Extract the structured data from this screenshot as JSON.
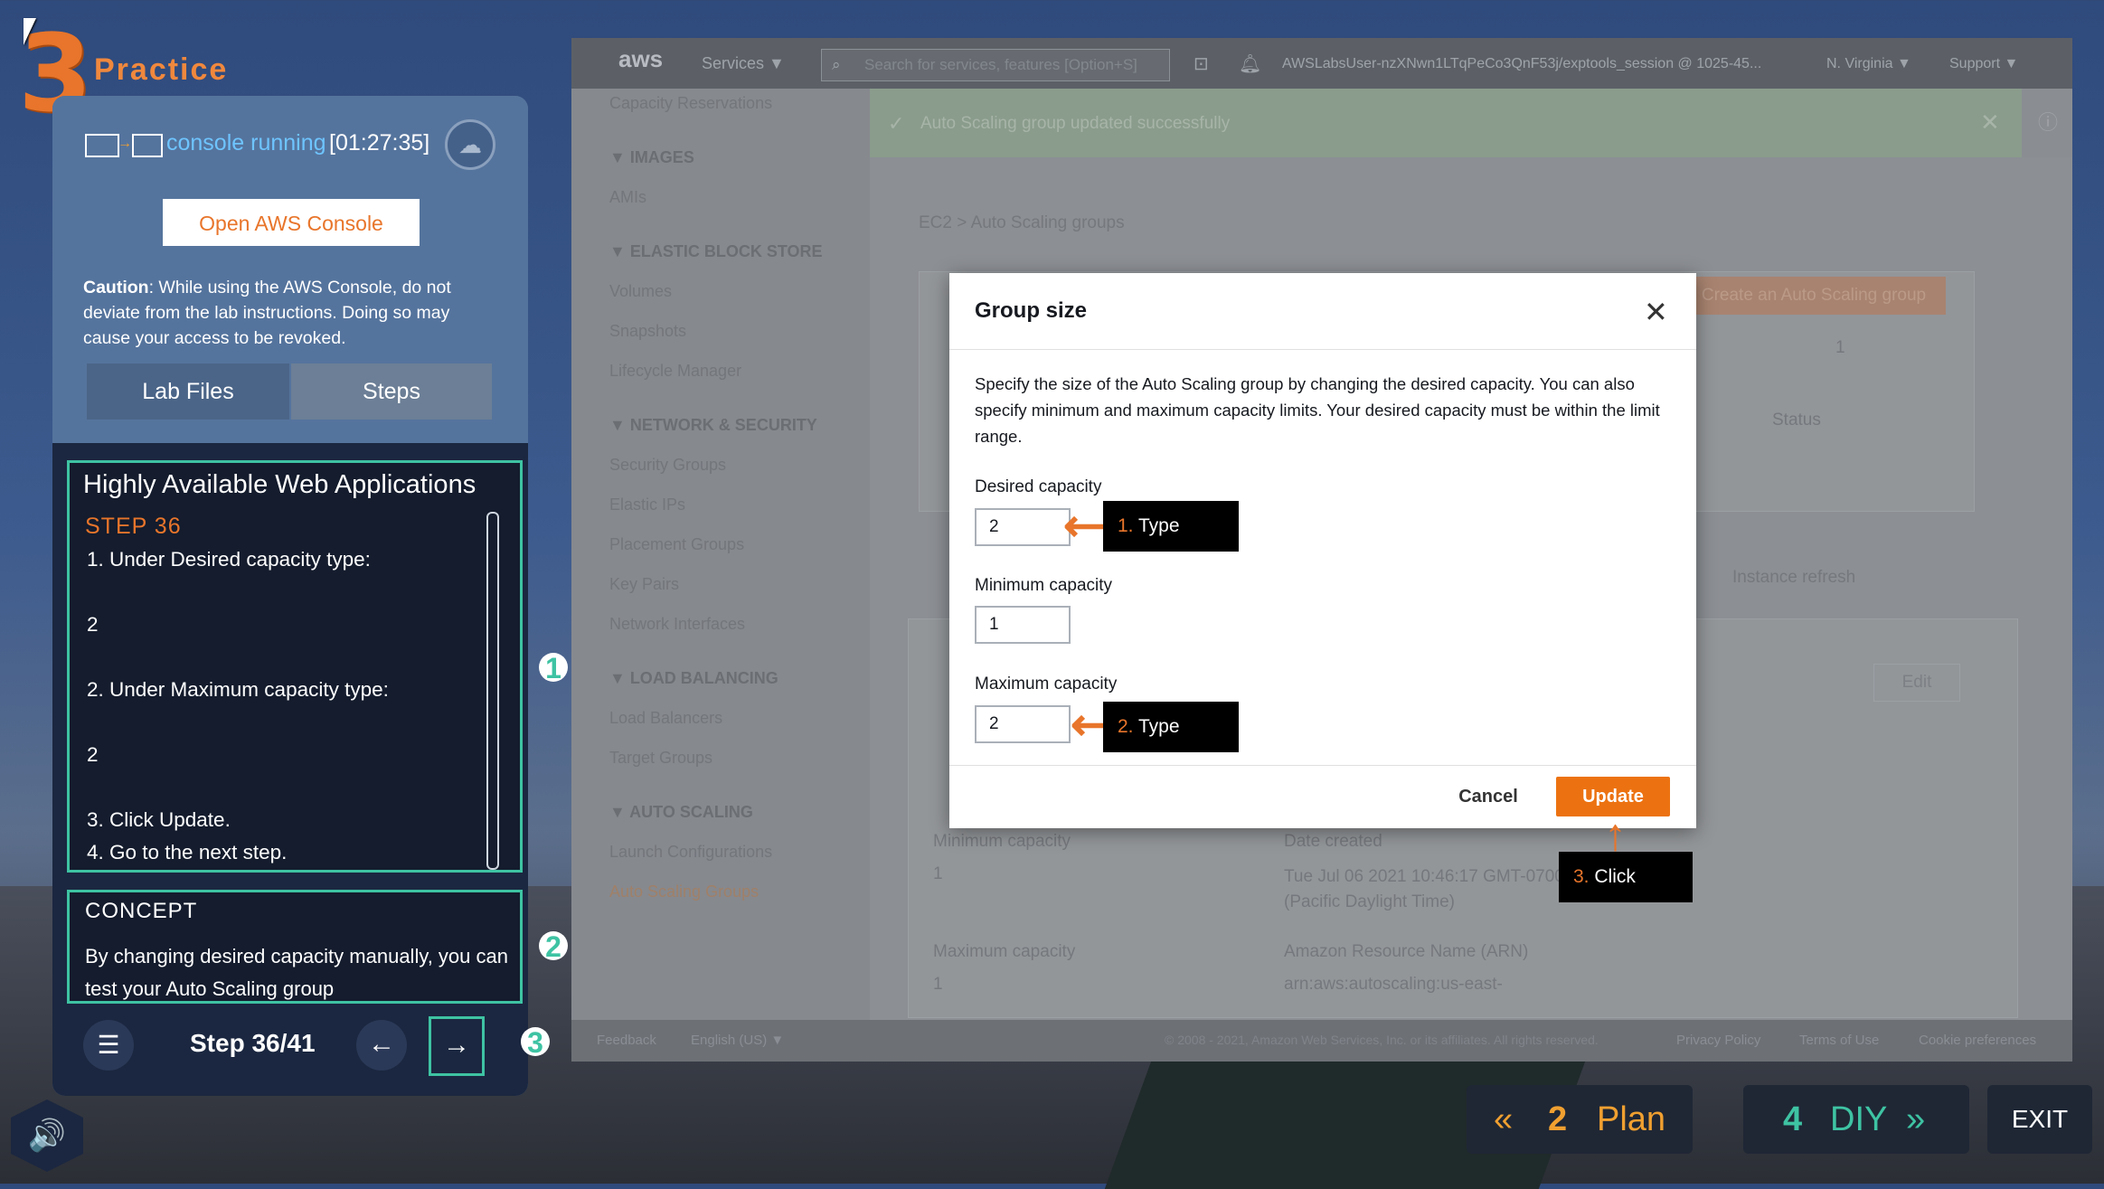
{
  "app": {
    "logo_number": "3",
    "logo_label": "Practice"
  },
  "status": {
    "console_label": "console running",
    "timer": "[01:27:35]"
  },
  "open_console_label": "Open AWS Console",
  "caution": {
    "bold": "Caution",
    "text": ": While using the AWS Console, do not deviate from the lab instructions. Doing so may cause your access to be revoked."
  },
  "tabs": [
    {
      "label": "Lab Files"
    },
    {
      "label": "Steps"
    }
  ],
  "step": {
    "title": "Highly Available Web Applications",
    "number": "STEP 36",
    "lines": [
      "1. Under Desired capacity type:",
      "2",
      "2. Under Maximum capacity type:",
      "2",
      "3. Click Update.",
      "4. Go to the next step."
    ]
  },
  "concept": {
    "title": "CONCEPT",
    "text": "By changing desired capacity manually, you can test your Auto Scaling group"
  },
  "badges": [
    "1",
    "2",
    "3"
  ],
  "nav": {
    "counter": "Step 36/41",
    "prev": "←",
    "next": "→",
    "list": "☰"
  },
  "console": {
    "logo": "aws",
    "services": "Services ▼",
    "search_placeholder": "Search for services, features [Option+S]",
    "account": "AWSLabsUser-nzXNwn1LTqPeCo3QnF53j/exptools_session @ 1025-45...",
    "region": "N. Virginia ▼",
    "support": "Support ▼",
    "banner": "Auto Scaling group updated successfully",
    "breadcrumb": "EC2  >  Auto Scaling groups",
    "create_btn": "Create an Auto Scaling group",
    "page_num": "1",
    "status_col": "Status",
    "instance_refresh": "Instance refresh",
    "edit": "Edit",
    "min_cap_label": "Minimum capacity",
    "min_cap_val": "1",
    "max_cap_label": "Maximum capacity",
    "max_cap_val": "1",
    "date_label": "Date created",
    "date_val": "Tue Jul 06 2021 10:46:17 GMT-0700 (Pacific Daylight Time)",
    "arn_label": "Amazon Resource Name (ARN)",
    "arn_val": "arn:aws:autoscaling:us-east-",
    "footer": [
      "Feedback",
      "English (US) ▼",
      "© 2008 - 2021, Amazon Web Services, Inc. or its affiliates. All rights reserved.",
      "Privacy Policy",
      "Terms of Use",
      "Cookie preferences"
    ],
    "sidebar": [
      {
        "type": "item",
        "label": "Capacity Reservations"
      },
      {
        "type": "head",
        "label": "▼  IMAGES"
      },
      {
        "type": "item",
        "label": "AMIs"
      },
      {
        "type": "head",
        "label": "▼  ELASTIC BLOCK STORE"
      },
      {
        "type": "item",
        "label": "Volumes"
      },
      {
        "type": "item",
        "label": "Snapshots"
      },
      {
        "type": "item",
        "label": "Lifecycle Manager"
      },
      {
        "type": "head",
        "label": "▼  NETWORK & SECURITY"
      },
      {
        "type": "item",
        "label": "Security Groups"
      },
      {
        "type": "item",
        "label": "Elastic IPs"
      },
      {
        "type": "item",
        "label": "Placement Groups"
      },
      {
        "type": "item",
        "label": "Key Pairs"
      },
      {
        "type": "item",
        "label": "Network Interfaces"
      },
      {
        "type": "head",
        "label": "▼  LOAD BALANCING"
      },
      {
        "type": "item",
        "label": "Load Balancers"
      },
      {
        "type": "item",
        "label": "Target Groups"
      },
      {
        "type": "head",
        "label": "▼  AUTO SCALING"
      },
      {
        "type": "item",
        "label": "Launch Configurations"
      },
      {
        "type": "item",
        "label": "Auto Scaling Groups"
      }
    ]
  },
  "modal": {
    "title": "Group size",
    "description": "Specify the size of the Auto Scaling group by changing the desired capacity. You can also specify minimum and maximum capacity limits. Your desired capacity must be within the limit range.",
    "desired_label": "Desired capacity",
    "desired_value": "2",
    "min_label": "Minimum capacity",
    "min_value": "1",
    "max_label": "Maximum capacity",
    "max_value": "2",
    "cancel": "Cancel",
    "update": "Update"
  },
  "callouts": [
    {
      "num": "1.",
      "text": "Type"
    },
    {
      "num": "2.",
      "text": "Type"
    },
    {
      "num": "3.",
      "text": "Click"
    }
  ],
  "bottom": {
    "plan_num": "2",
    "plan_label": "Plan",
    "diy_num": "4",
    "diy_label": "DIY",
    "exit": "EXIT"
  },
  "colors": {
    "accent": "#e8752b",
    "teal": "#3ec3a3",
    "aws_orange": "#ec7211"
  }
}
